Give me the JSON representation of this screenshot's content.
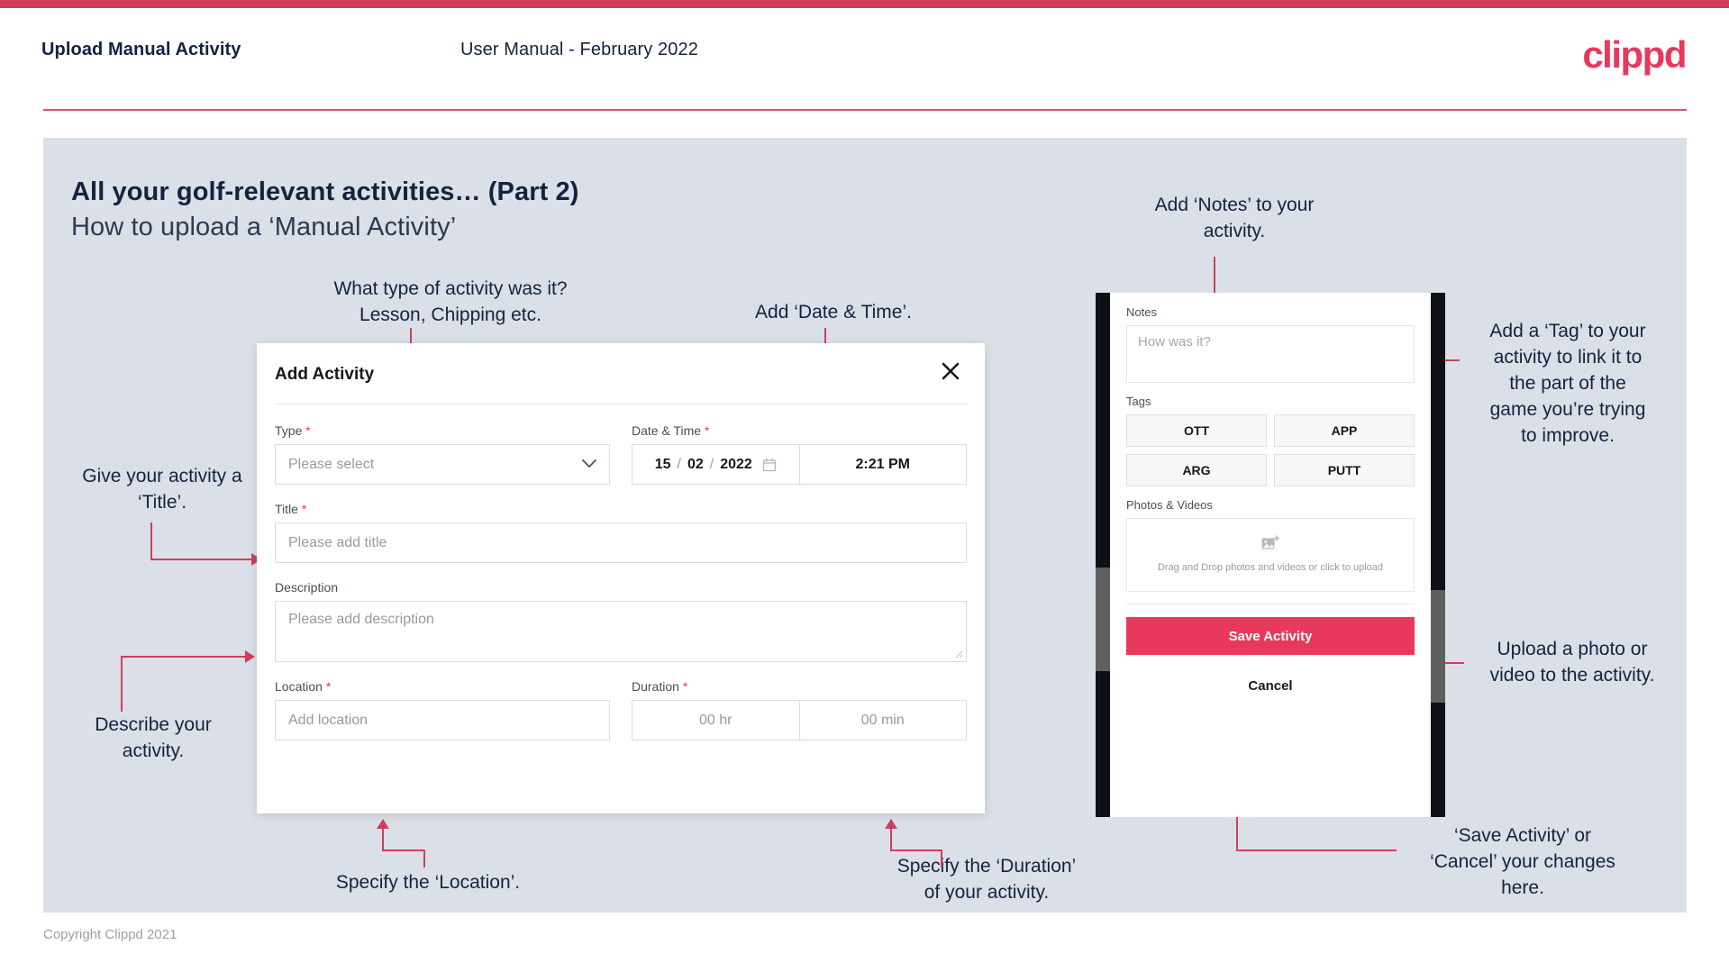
{
  "header": {
    "title": "Upload Manual Activity",
    "subtitle": "User Manual - February 2022",
    "logo": "clippd"
  },
  "slide": {
    "title_bold": "All your golf-relevant activities… (Part 2)",
    "title_light": "How to upload a ‘Manual Activity’"
  },
  "annotations": {
    "type": "What type of activity was it?\nLesson, Chipping etc.",
    "datetime": "Add ‘Date & Time’.",
    "notes": "Add ‘Notes’ to your\nactivity.",
    "tag": "Add a ‘Tag’ to your\nactivity to link it to\nthe part of the\ngame you’re trying\nto improve.",
    "title": "Give your activity a\n‘Title’.",
    "describe": "Describe your\nactivity.",
    "upload": "Upload a photo or\nvideo to the activity.",
    "location": "Specify the ‘Location’.",
    "duration": "Specify the ‘Duration’\nof your activity.",
    "save_cancel": "‘Save Activity’ or\n‘Cancel’ your changes\nhere."
  },
  "dialog": {
    "title": "Add Activity",
    "close_icon": "close-icon",
    "type": {
      "label": "Type",
      "required": "*",
      "placeholder": "Please select",
      "chevron": "chevron-down-icon"
    },
    "datetime": {
      "label": "Date & Time",
      "required": "*",
      "day": "15",
      "sep1": "/",
      "month": "02",
      "sep2": "/",
      "year": "2022",
      "calendar_icon": "calendar-icon",
      "time": "2:21 PM"
    },
    "title_field": {
      "label": "Title",
      "required": "*",
      "placeholder": "Please add title"
    },
    "description": {
      "label": "Description",
      "placeholder": "Please add description"
    },
    "location": {
      "label": "Location",
      "required": "*",
      "placeholder": "Add location"
    },
    "duration": {
      "label": "Duration",
      "required": "*",
      "hours_placeholder": "00 hr",
      "minutes_placeholder": "00 min"
    }
  },
  "phone": {
    "notes": {
      "label": "Notes",
      "placeholder": "How was it?"
    },
    "tags": {
      "label": "Tags",
      "items": [
        "OTT",
        "APP",
        "ARG",
        "PUTT"
      ]
    },
    "photos": {
      "label": "Photos & Videos",
      "icon": "add-image-icon",
      "dropzone_text": "Drag and Drop photos and videos or click to upload"
    },
    "save_label": "Save Activity",
    "cancel_label": "Cancel"
  },
  "footer": {
    "copyright": "Copyright Clippd 2021"
  },
  "colors": {
    "accent": "#e8395c",
    "arrow": "#cf3f5b",
    "slide_bg": "#dbe0e8",
    "text_dark": "#13233f"
  }
}
